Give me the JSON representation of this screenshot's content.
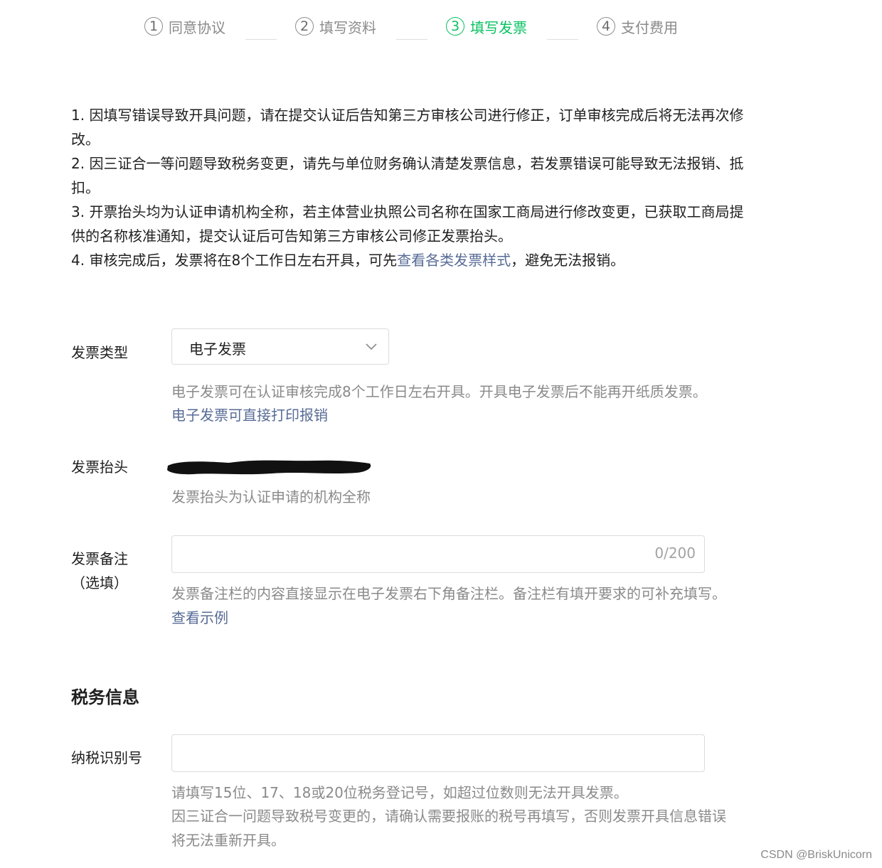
{
  "steps": [
    {
      "num": "1",
      "label": "同意协议"
    },
    {
      "num": "2",
      "label": "填写资料"
    },
    {
      "num": "3",
      "label": "填写发票"
    },
    {
      "num": "4",
      "label": "支付费用"
    }
  ],
  "accent_color": "#07c160",
  "link_color": "#576b95",
  "notice": {
    "item1": "1. 因填写错误导致开具问题，请在提交认证后告知第三方审核公司进行修正，订单审核完成后将无法再次修改。",
    "item2": "2. 因三证合一等问题导致税务变更，请先与单位财务确认清楚发票信息，若发票错误可能导致无法报销、抵扣。",
    "item3": "3. 开票抬头均为认证申请机构全称，若主体营业执照公司名称在国家工商局进行修改变更，已获取工商局提供的名称核准通知，提交认证后可告知第三方审核公司修正发票抬头。",
    "item4_before": "4. 审核完成后，发票将在8个工作日左右开具，可先",
    "item4_link": "查看各类发票样式",
    "item4_after": "，避免无法报销。"
  },
  "invoice_type": {
    "label": "发票类型",
    "value": "电子发票",
    "hint": "电子发票可在认证审核完成8个工作日左右开具。开具电子发票后不能再开纸质发票。",
    "hint_link": "电子发票可直接打印报销"
  },
  "invoice_title": {
    "label": "发票抬头",
    "hint": "发票抬头为认证申请的机构全称"
  },
  "invoice_remark": {
    "label": "发票备注",
    "label_sub": "（选填）",
    "counter": "0/200",
    "hint": "发票备注栏的内容直接显示在电子发票右下角备注栏。备注栏有填开要求的可补充填写。",
    "hint_link": "查看示例"
  },
  "tax_section": {
    "title": "税务信息",
    "tax_id_label": "纳税识别号",
    "hint1": "请填写15位、17、18或20位税务登记号，如超过位数则无法开具发票。",
    "hint2": "因三证合一问题导致税号变更的，请确认需要报账的税号再填写，否则发票开具信息错误",
    "hint3": "将无法重新开具。"
  },
  "watermark": "CSDN @BriskUnicorn"
}
